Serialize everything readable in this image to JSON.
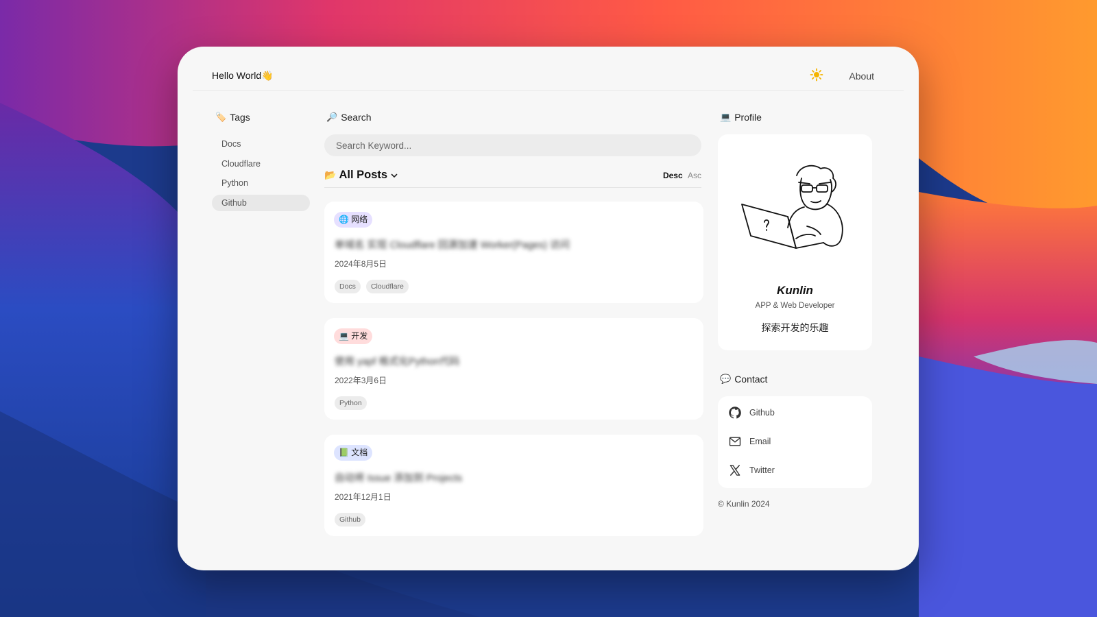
{
  "header": {
    "site_title": "Hello World👋",
    "about_label": "About",
    "theme_icon": "sun-icon"
  },
  "tags": {
    "title": "Tags",
    "emoji": "🏷️",
    "items": [
      {
        "label": "Docs"
      },
      {
        "label": "Cloudflare"
      },
      {
        "label": "Python"
      },
      {
        "label": "Github"
      }
    ],
    "active": "Github"
  },
  "search": {
    "title": "Search",
    "emoji": "🔎",
    "placeholder": "Search Keyword..."
  },
  "posts": {
    "title": "All Posts",
    "emoji": "📂",
    "sort_desc": "Desc",
    "sort_asc": "Asc",
    "items": [
      {
        "category": "网络",
        "category_emoji": "🌐",
        "category_color": "#e6e0ff",
        "title": "单域名 实现 Cloudflare 回源加速 Worker(Pages) 访问",
        "date": "2024年8月5日",
        "tags": [
          "Docs",
          "Cloudflare"
        ]
      },
      {
        "category": "开发",
        "category_emoji": "💻",
        "category_color": "#ffdcdc",
        "title": "使用 yapf 格式化Python代码",
        "date": "2022年3月6日",
        "tags": [
          "Python"
        ]
      },
      {
        "category": "文档",
        "category_emoji": "📗",
        "category_color": "#dde4ff",
        "title": "自动将 Issue 添加到 Projects",
        "date": "2021年12月1日",
        "tags": [
          "Github"
        ]
      }
    ]
  },
  "profile": {
    "title": "Profile",
    "emoji": "💻",
    "name": "Kunlin",
    "role": "APP & Web Developer",
    "motto": "探索开发的乐趣"
  },
  "contact": {
    "title": "Contact",
    "emoji": "💬",
    "items": [
      {
        "label": "Github",
        "icon": "github-icon"
      },
      {
        "label": "Email",
        "icon": "mail-icon"
      },
      {
        "label": "Twitter",
        "icon": "x-twitter-icon"
      }
    ]
  },
  "footer": {
    "copyright": "© Kunlin 2024"
  }
}
